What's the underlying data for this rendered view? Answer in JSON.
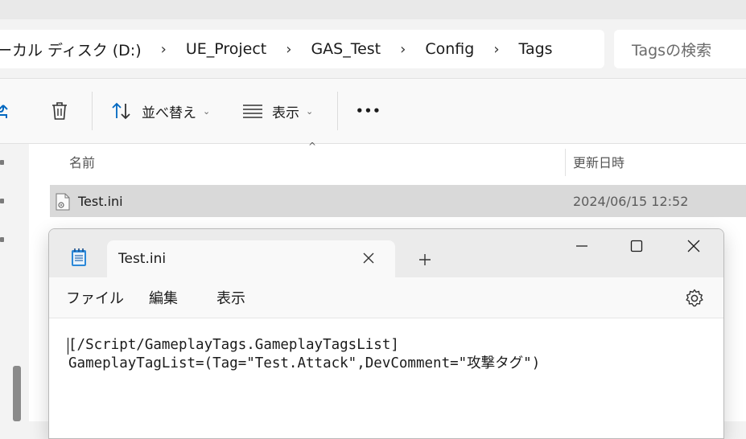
{
  "explorer": {
    "breadcrumb": {
      "drive": "ーカル ディスク (D:)",
      "items": [
        "UE_Project",
        "GAS_Test",
        "Config",
        "Tags"
      ],
      "separator": "›"
    },
    "search": {
      "placeholder": "Tagsの検索"
    },
    "toolbar": {
      "sort_label": "並べ替え",
      "view_label": "表示",
      "more_label": "•••"
    },
    "columns": {
      "name": "名前",
      "modified": "更新日時"
    },
    "files": [
      {
        "name": "Test.ini",
        "modified": "2024/06/15 12:52",
        "icon": "ini-file-icon"
      }
    ]
  },
  "notepad": {
    "tab_title": "Test.ini",
    "menu": {
      "file": "ファイル",
      "edit": "編集",
      "view": "表示"
    },
    "lines": [
      "[/Script/GameplayTags.GameplayTagsList]",
      "GameplayTagList=(Tag=\"Test.Attack\",DevComment=\"攻撃タグ\")"
    ]
  },
  "colors": {
    "selection": "#d9d9d9",
    "accent": "#0067c0",
    "notepad_icon": "#1e7fd3"
  }
}
